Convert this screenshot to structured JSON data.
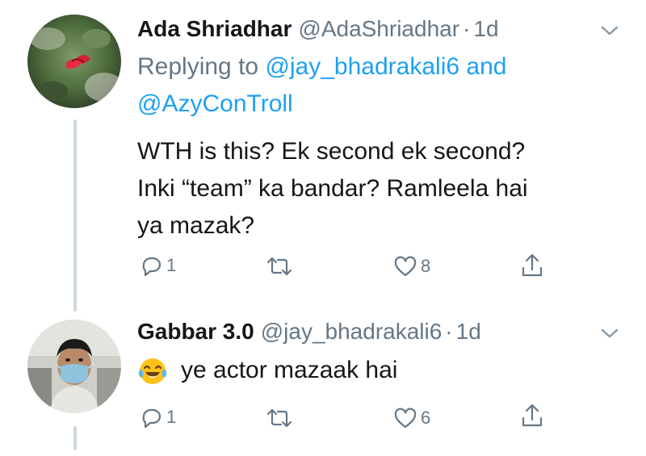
{
  "tweets": [
    {
      "name": "Ada Shriadhar",
      "handle": "@AdaShriadhar",
      "separator": "·",
      "time": "1d",
      "reply_prefix": "Replying to ",
      "reply_mention_1": "@jay_bhadrakali6",
      "reply_and": " and",
      "reply_mention_2": "@AzyConTroll",
      "text_lines": [
        "WTH is this? Ek second ek second?",
        "Inki “team” ka bandar? Ramleela hai",
        "ya mazak?"
      ],
      "actions": {
        "reply_count": "1",
        "retweet_count": "",
        "like_count": "8"
      }
    },
    {
      "name": "Gabbar 3.0",
      "handle": "@jay_bhadrakali6",
      "separator": "·",
      "time": "1d",
      "text": "ye actor mazaak hai",
      "emoji": "face-with-tears-of-joy",
      "actions": {
        "reply_count": "1",
        "retweet_count": "",
        "like_count": "6"
      }
    }
  ],
  "colors": {
    "text": "#14171a",
    "secondary": "#657786",
    "link": "#1da1f2",
    "thread_line": "#cfd9de"
  },
  "icons": [
    "reply-icon",
    "retweet-icon",
    "like-icon",
    "share-icon",
    "chevron-down-icon"
  ]
}
